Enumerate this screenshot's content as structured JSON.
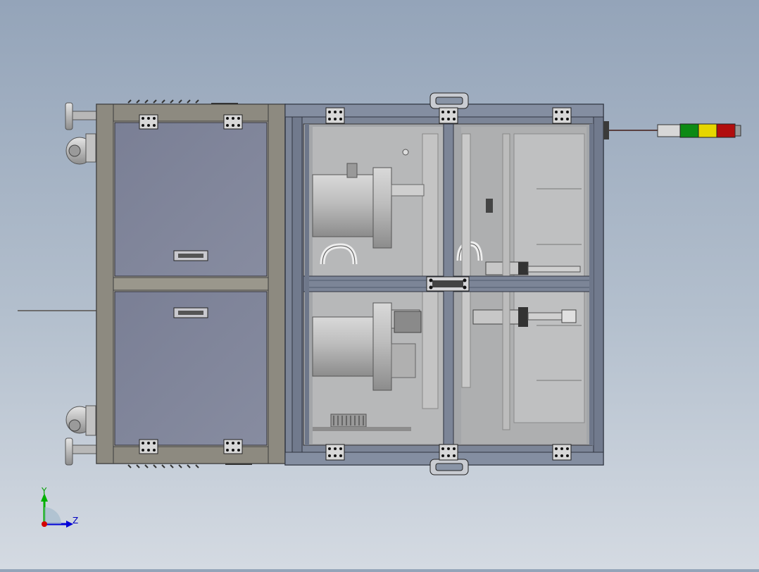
{
  "viewport": {
    "background_top": "#94a4b9",
    "background_bottom": "#d4dae2",
    "model": "machine-cabinet-assembly"
  },
  "colors": {
    "frame_dark": "#6f6b62",
    "frame_light": "#a8a59a",
    "door_panel": "#7f8499",
    "aluminium_profile": "#7c8597",
    "glass": "#9da0a5",
    "interior": "#b9babb",
    "signal_red": "#b10d0d",
    "signal_yellow": "#e6d600",
    "signal_green": "#0c8a14"
  },
  "signal_tower": {
    "icon": "signal-tower-icon",
    "lights": [
      "green",
      "yellow",
      "red"
    ]
  },
  "triad": {
    "y_label": "Y",
    "z_label": "Z",
    "x_color": "#d40000",
    "y_color": "#00b000",
    "z_color": "#0000d8"
  }
}
